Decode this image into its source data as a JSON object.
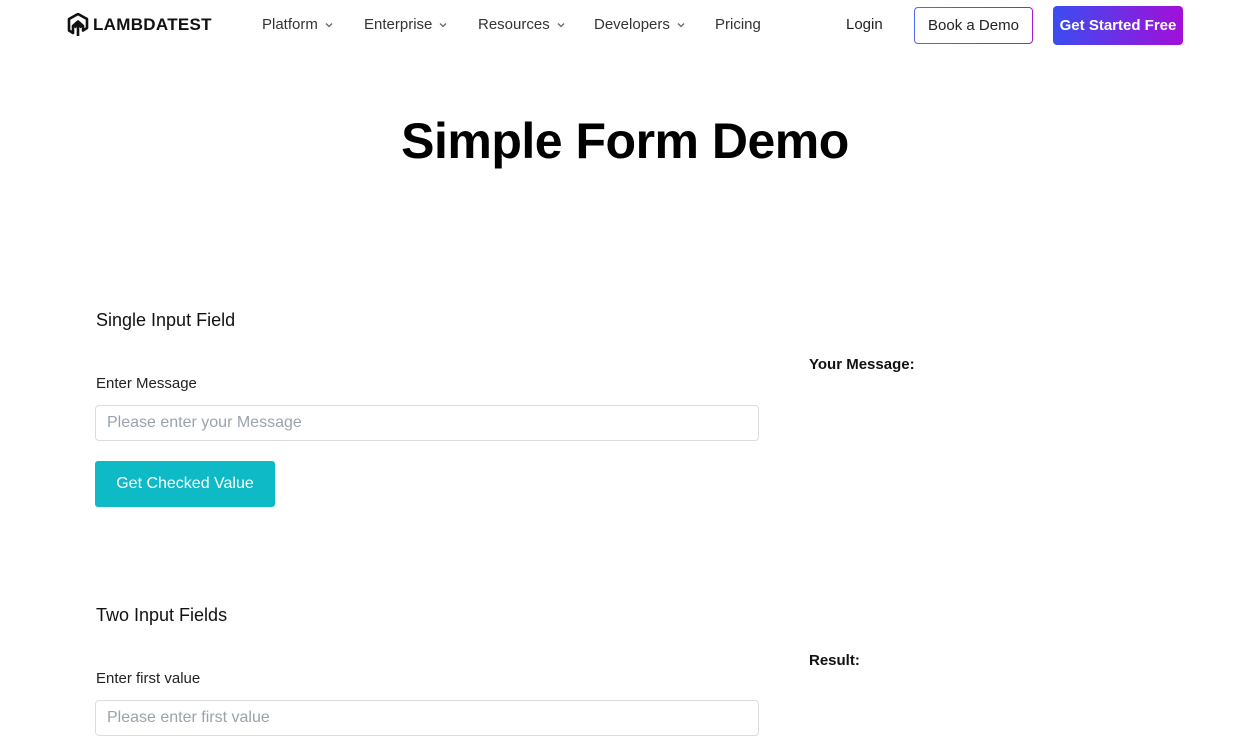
{
  "header": {
    "logo_text": "LAMBDATEST",
    "nav": [
      {
        "label": "Platform",
        "has_dropdown": true
      },
      {
        "label": "Enterprise",
        "has_dropdown": true
      },
      {
        "label": "Resources",
        "has_dropdown": true
      },
      {
        "label": "Developers",
        "has_dropdown": true
      },
      {
        "label": "Pricing",
        "has_dropdown": false
      }
    ],
    "login_label": "Login",
    "book_demo_label": "Book a Demo",
    "get_started_label": "Get Started Free"
  },
  "page": {
    "title": "Simple Form Demo"
  },
  "single_input": {
    "section_title": "Single Input Field",
    "field_label": "Enter Message",
    "input_value": "",
    "input_placeholder": "Please enter your Message",
    "button_label": "Get Checked Value",
    "output_label": "Your Message:",
    "output_value": ""
  },
  "two_inputs": {
    "section_title": "Two Input Fields",
    "first_label": "Enter first value",
    "first_value": "",
    "first_placeholder": "Please enter first value",
    "result_label": "Result:",
    "result_value": ""
  },
  "colors": {
    "primary_button": "#0ebac5",
    "gradient_start": "#3a4df0",
    "gradient_end": "#a20fd8"
  }
}
